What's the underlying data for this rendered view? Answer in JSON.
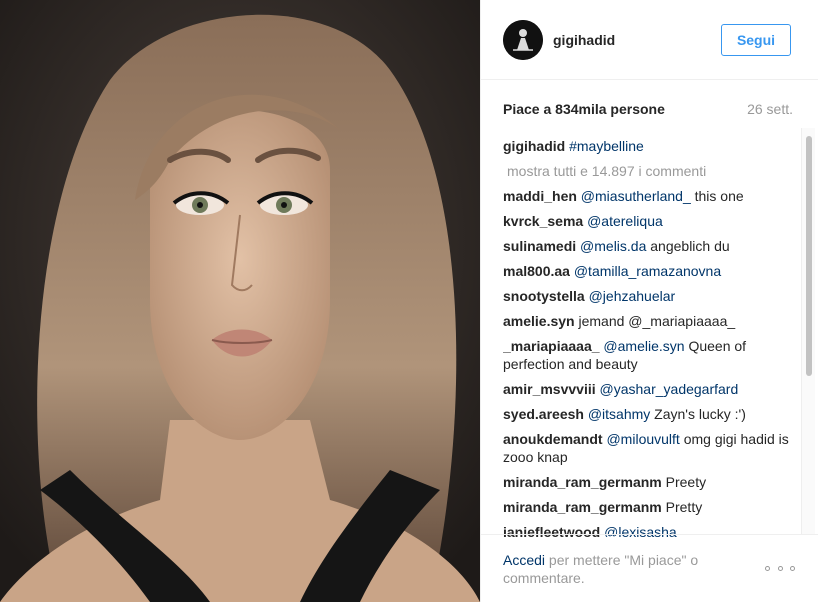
{
  "post": {
    "username": "gigihadid",
    "follow_label": "Segui",
    "likes_text": "Piace a 834mila persone",
    "date": "26 sett."
  },
  "caption": {
    "user": "gigihadid",
    "text": "#maybelline"
  },
  "view_all_comments": "mostra tutti e 14.897 i commenti",
  "comments": [
    {
      "user": "maddi_hen",
      "tag": "@miasutherland_",
      "text": " this one"
    },
    {
      "user": "kvrck_sema",
      "tag": "@atereliqua",
      "text": ""
    },
    {
      "user": "sulinamedi",
      "tag": "@melis.da",
      "text": " angeblich du"
    },
    {
      "user": "mal800.aa",
      "tag": "@tamilla_ramazanovna",
      "text": ""
    },
    {
      "user": "snootystella",
      "tag": "@jehzahuelar",
      "text": ""
    },
    {
      "user": "amelie.syn",
      "tag": "",
      "text": " jemand @_mariapiaaaa_"
    },
    {
      "user": "_mariapiaaaa_",
      "tag": "@amelie.syn",
      "text": " Queen of perfection and beauty"
    },
    {
      "user": "amir_msvvviii",
      "tag": "@yashar_yadegarfard",
      "text": ""
    },
    {
      "user": "syed.areesh",
      "tag": "@itsahmy",
      "text": " Zayn's lucky :')"
    },
    {
      "user": "anoukdemandt",
      "tag": "@milouvulft",
      "text": " omg gigi hadid is zooo knap"
    },
    {
      "user": "miranda_ram_germanm",
      "tag": "",
      "text": " Preety"
    },
    {
      "user": "miranda_ram_germanm",
      "tag": "",
      "text": " Pretty"
    },
    {
      "user": "janiefleetwood",
      "tag": "@lexisasha",
      "text": ""
    }
  ],
  "footer": {
    "login_link": "Accedi",
    "login_text": " per mettere \"Mi piace\" o commentare."
  },
  "icons": {
    "more": "more-options-icon",
    "avatar": "profile-avatar"
  }
}
